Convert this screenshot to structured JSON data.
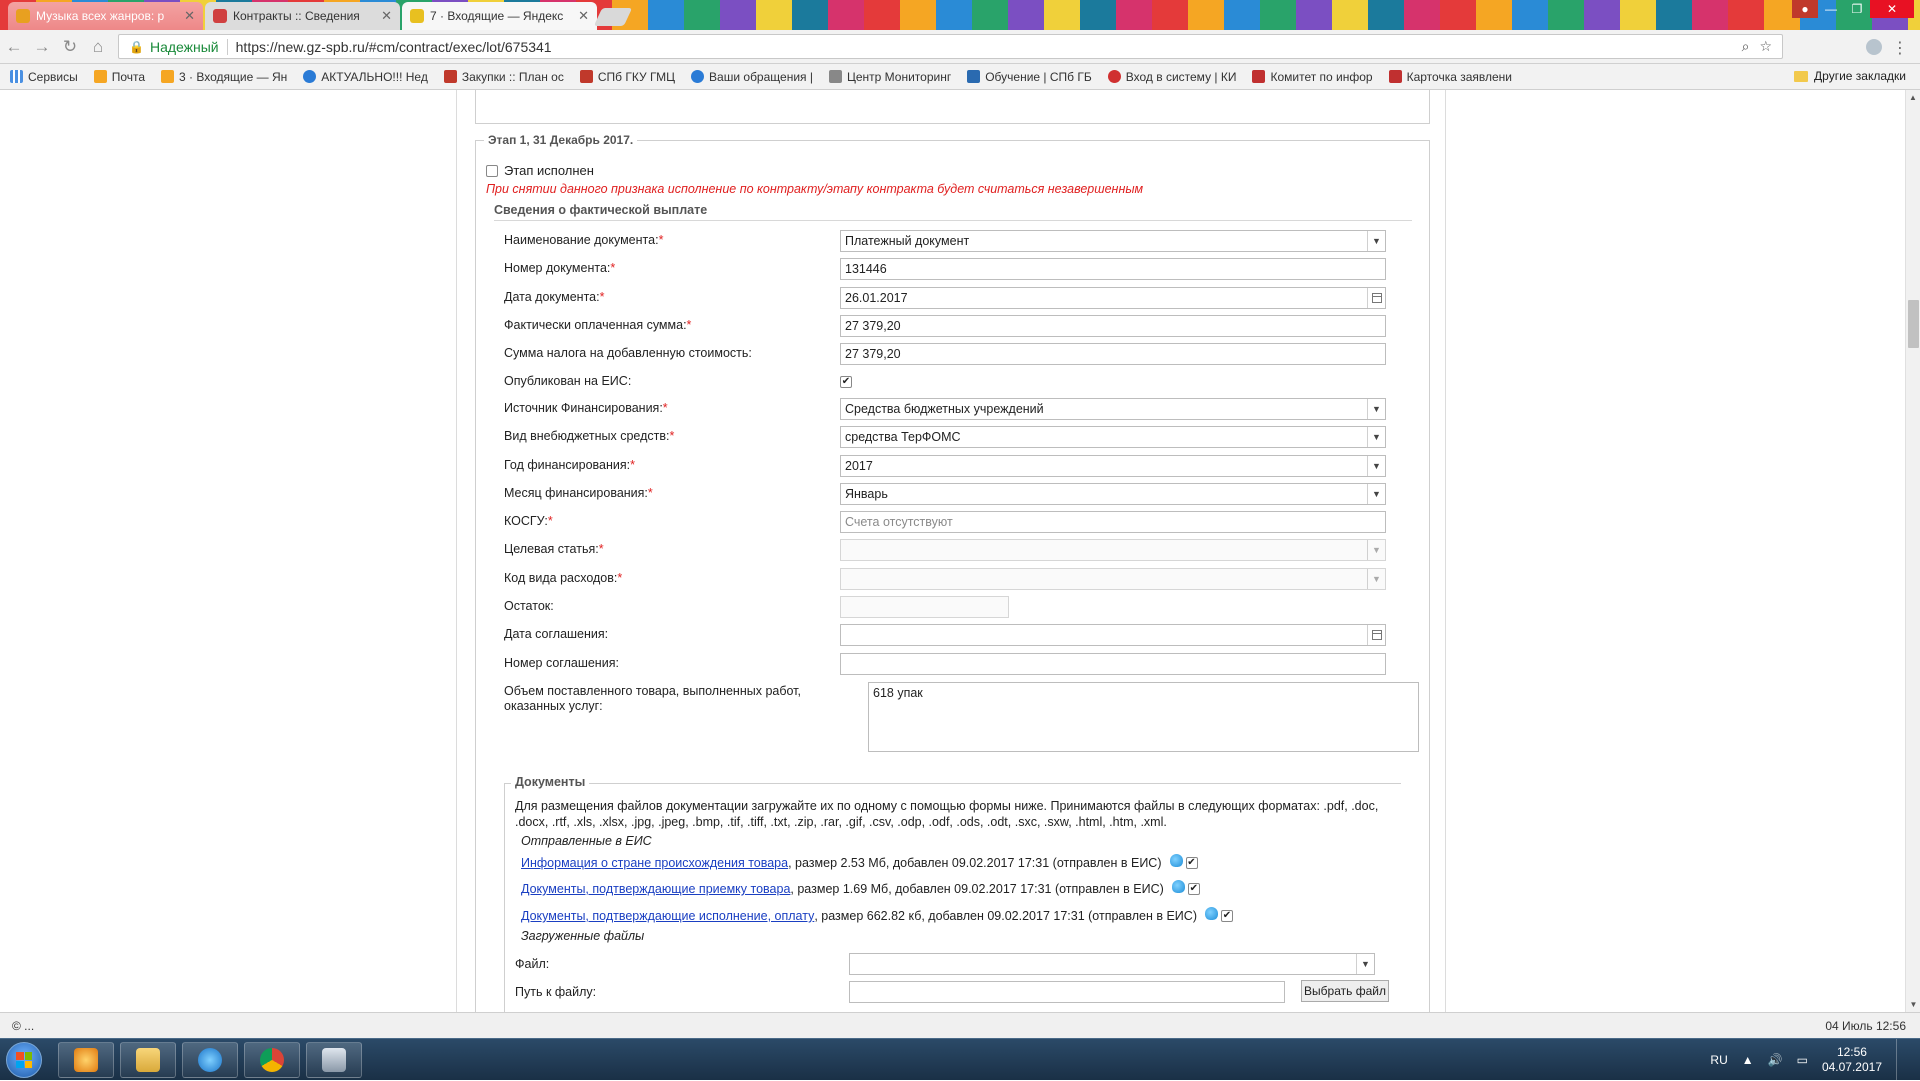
{
  "browser": {
    "tabs": [
      {
        "title": "Музыка всех жанров: р",
        "icon_color": "#e8a020"
      },
      {
        "title": "Контракты :: Сведения",
        "icon_color": "#d04040"
      },
      {
        "title": "7 · Входящие — Яндекс",
        "icon_color": "#e8c020"
      }
    ],
    "close_glyph": "✕",
    "secure_label": "Надежный",
    "url": "https://new.gz-spb.ru/#cm/contract/exec/lot/675341"
  },
  "bookmarks": {
    "items": [
      {
        "label": "Сервисы",
        "color": "#4a90e2"
      },
      {
        "label": "Почта",
        "color": "#f5a623"
      },
      {
        "label": "3 · Входящие — Ян",
        "color": "#f5a623"
      },
      {
        "label": "АКТУАЛЬНО!!! Нед",
        "color": "#2a7bd6"
      },
      {
        "label": "Закупки :: План ос",
        "color": "#c0392b"
      },
      {
        "label": "СПб ГКУ ГМЦ",
        "color": "#c0392b"
      },
      {
        "label": "Ваши обращения |",
        "color": "#2a7bd6"
      },
      {
        "label": "Центр Мониторинг",
        "color": "#888888"
      },
      {
        "label": "Обучение | СПб ГБ",
        "color": "#2a6ab0"
      },
      {
        "label": "Вход в систему | КИ",
        "color": "#d03030"
      },
      {
        "label": "Комитет по инфор",
        "color": "#c03030"
      },
      {
        "label": "Карточка заявлени",
        "color": "#c03030"
      }
    ],
    "other": "Другие закладки"
  },
  "stage": {
    "legend": "Этап 1, 31 Декабрь 2017.",
    "executed_label": "Этап исполнен",
    "executed_checked": false,
    "warning": "При снятии данного признака исполнение по контракту/этапу контракта будет считаться незавершенным"
  },
  "payment": {
    "section_title": "Сведения о фактической выплате",
    "fields": {
      "doc_name": {
        "label": "Наименование документа:",
        "value": "Платежный документ"
      },
      "doc_number": {
        "label": "Номер документа:",
        "value": "131446"
      },
      "doc_date": {
        "label": "Дата документа:",
        "value": "26.01.2017"
      },
      "paid_sum": {
        "label": "Фактически оплаченная сумма:",
        "value": "27 379,20"
      },
      "vat_sum": {
        "label": "Сумма налога на добавленную стоимость:",
        "value": "27 379,20"
      },
      "published": {
        "label": "Опубликован на ЕИС:",
        "checked": true
      },
      "fin_source": {
        "label": "Источник Финансирования:",
        "value": "Средства бюджетных учреждений"
      },
      "offbudget_type": {
        "label": "Вид внебюджетных средств:",
        "value": "средства ТерФОМС"
      },
      "fin_year": {
        "label": "Год финансирования:",
        "value": "2017"
      },
      "fin_month": {
        "label": "Месяц финансирования:",
        "value": "Январь"
      },
      "kosgu": {
        "label": "КОСГУ:",
        "placeholder": "Счета отсутствуют"
      },
      "target_article": {
        "label": "Целевая статья:",
        "value": ""
      },
      "expense_code": {
        "label": "Код вида расходов:",
        "value": ""
      },
      "remainder": {
        "label": "Остаток:",
        "value": ""
      },
      "agreement_date": {
        "label": "Дата соглашения:",
        "value": ""
      },
      "agreement_number": {
        "label": "Номер соглашения:",
        "value": ""
      },
      "volume": {
        "label": "Объем поставленного товара, выполненных работ, оказанных услуг:",
        "value": "618 упак"
      }
    },
    "required_mark": "*"
  },
  "documents": {
    "legend": "Документы",
    "help": "Для размещения файлов документации загружайте их по одному с помощью формы ниже. Принимаются файлы в следующих форматах: .pdf, .doc, .docx, .rtf, .xls, .xlsx, .jpg, .jpeg, .bmp, .tif, .tiff, .txt, .zip, .rar, .gif, .csv, .odp, .odf, .ods, .odt, .sxc, .sxw, .html, .htm, .xml.",
    "sent_title": "Отправленные в ЕИС",
    "sent": [
      {
        "link": "Информация о стране происхождения товара",
        "meta": ", размер 2.53 Мб, добавлен 09.02.2017 17:31 (отправлен в ЕИС)"
      },
      {
        "link": "Документы, подтверждающие приемку товара",
        "meta": ", размер 1.69 Мб, добавлен 09.02.2017 17:31 (отправлен в ЕИС)"
      },
      {
        "link": "Документы, подтверждающие исполнение, оплату",
        "meta": ", размер 662.82 кб, добавлен 09.02.2017 17:31 (отправлен в ЕИС)"
      }
    ],
    "uploaded_title": "Загруженные файлы",
    "file_label": "Файл:",
    "path_label": "Путь к файлу:",
    "choose_button": "Выбрать файл"
  },
  "status": {
    "left": "© ...",
    "right": "04 Июль 12:56"
  },
  "taskbar": {
    "lang": "RU",
    "time": "12:56",
    "date": "04.07.2017"
  }
}
